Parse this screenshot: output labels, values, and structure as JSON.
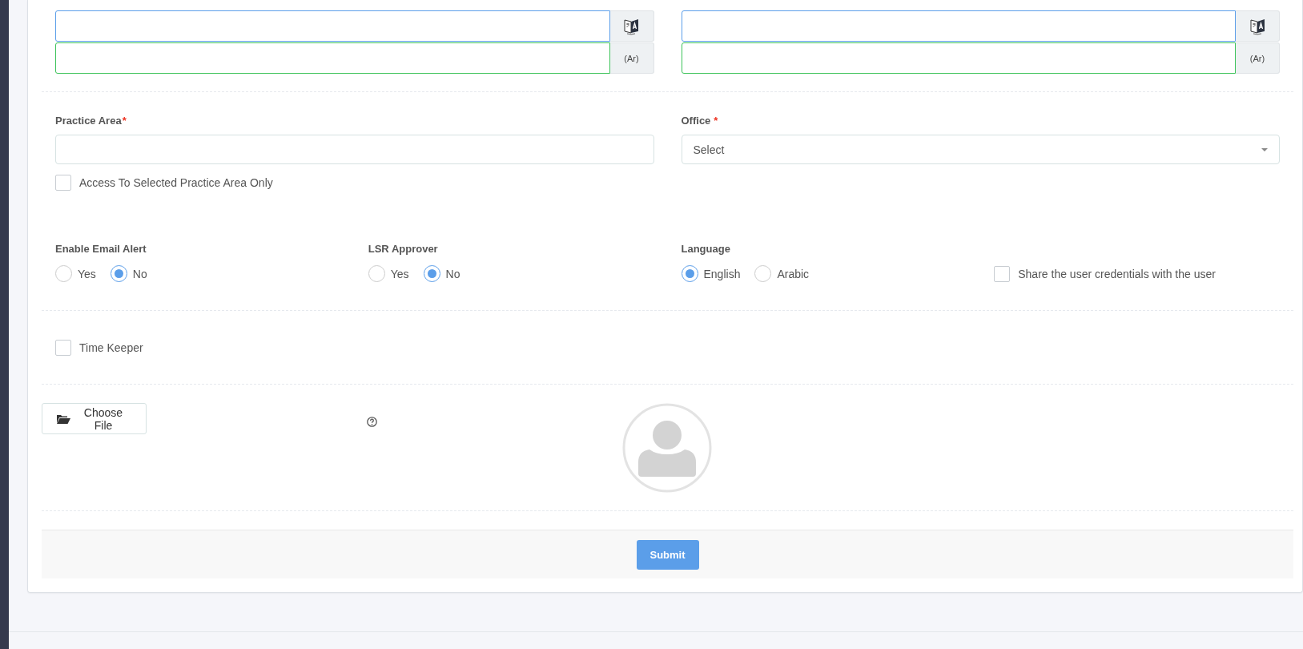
{
  "name_fields": [
    {
      "arabic_addon": "(Ar)"
    },
    {
      "arabic_addon": "(Ar)"
    }
  ],
  "practice_area": {
    "label": "Practice Area",
    "required_mark": "*"
  },
  "access_only": {
    "label": "Access To Selected Practice Area Only",
    "checked": false
  },
  "office": {
    "label": "Office",
    "required_mark": "*",
    "value": "Select"
  },
  "radio_groups": [
    {
      "label": "Enable Email Alert",
      "options": [
        {
          "label": "Yes",
          "selected": false
        },
        {
          "label": "No",
          "selected": true
        }
      ]
    },
    {
      "label": "LSR Approver",
      "options": [
        {
          "label": "Yes",
          "selected": false
        },
        {
          "label": "No",
          "selected": true
        }
      ]
    },
    {
      "label": "Language",
      "options": [
        {
          "label": "English",
          "selected": true
        },
        {
          "label": "Arabic",
          "selected": false
        }
      ]
    }
  ],
  "share_credentials": {
    "label": "Share the user credentials with the user",
    "checked": false
  },
  "time_keeper": {
    "label": "Time Keeper",
    "checked": false
  },
  "choose_file_button": "Choose File",
  "submit_button": "Submit"
}
